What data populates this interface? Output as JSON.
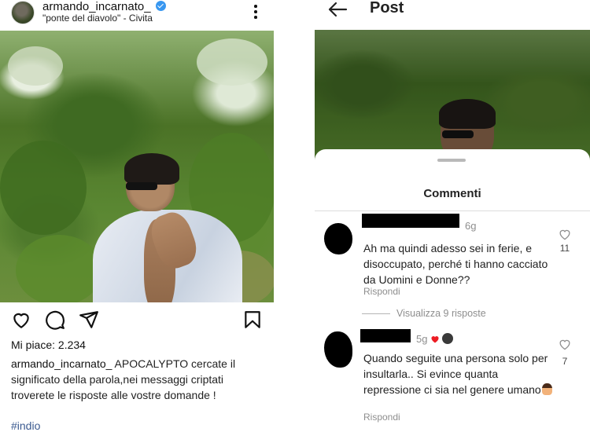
{
  "post": {
    "username": "armando_incarnato_",
    "location": "\"ponte del diavolo\" - Civita",
    "likes": "Mi piace: 2.234",
    "caption_user": "armando_incarnato_",
    "caption_text": "APOCALYPTO cercate il significato della parola,nei messaggi criptati troverete le risposte alle vostre domande !",
    "hashtag": "#indio",
    "icons": [
      "heart-icon",
      "comment-icon",
      "share-icon",
      "bookmark-icon",
      "more-icon",
      "verified-icon"
    ]
  },
  "comments_view": {
    "header_title": "Post",
    "sheet_title": "Commenti",
    "comments": [
      {
        "time": "6g",
        "text": "Ah ma quindi adesso sei in ferie, e disoccupato, perché ti hanno cacciato da Uomini e Donne??",
        "reply_label": "Rispondi",
        "like_count": "11",
        "view_replies": "Visualizza 9 risposte"
      },
      {
        "time": "5g",
        "text": "Quando seguite una persona solo per insultarla.. Si evince quanta repressione ci sia nel genere umano",
        "reply_label": "Rispondi",
        "like_count": "7"
      }
    ],
    "colors": {
      "muted": "#8e8e8e",
      "heart_red": "#ed1c24",
      "link": "#3b5a90"
    }
  }
}
